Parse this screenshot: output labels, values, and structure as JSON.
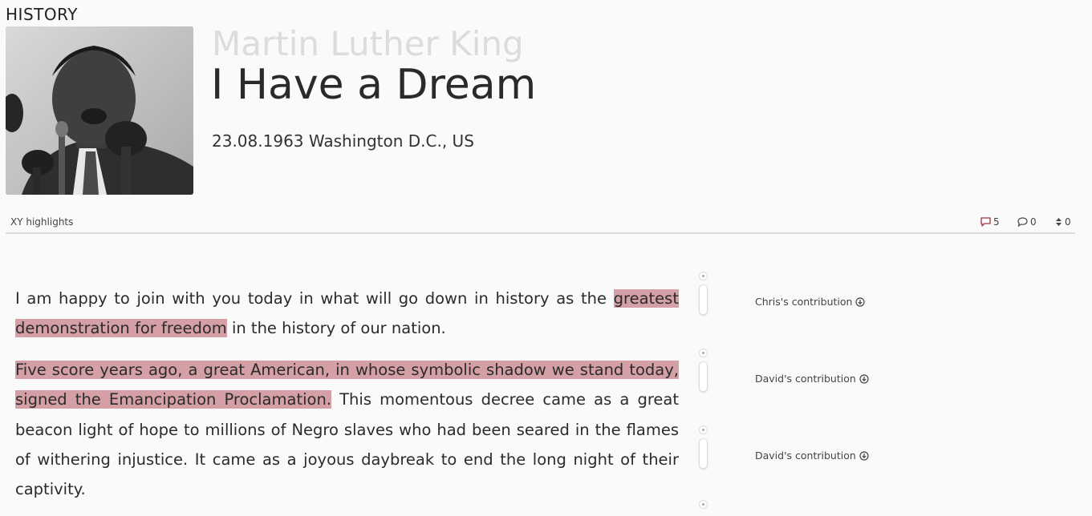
{
  "header": {
    "category": "HISTORY",
    "author": "Martin Luther King",
    "title": "I Have a Dream",
    "meta": "23.08.1963 Washington D.C., US"
  },
  "toolbar": {
    "highlights_label": "XY highlights",
    "stats": [
      {
        "icon": "comment-icon",
        "value": "5",
        "color": "#a0323c"
      },
      {
        "icon": "chat-bubble-icon",
        "value": "0",
        "color": "#444444"
      },
      {
        "icon": "sort-arrows-icon",
        "value": "0",
        "color": "#444444"
      }
    ]
  },
  "body": {
    "paragraphs": [
      {
        "highlight": "",
        "lead": "I am happy to join with you today in what will go down in history as the ",
        "marked": "greatest demonstration for freedom",
        "rest": " in the history of our nation."
      },
      {
        "lead": "",
        "marked": "Five score years ago, a great American, in whose symbolic shadow we stand today, signed the Emancipation Proclamation.",
        "rest": " This momentous decree came as a great beacon light of hope to millions of Negro slaves who had been seared in the flames of withering injustice. It came as a joyous daybreak to end the long night of their captivity."
      }
    ]
  },
  "contributions": [
    {
      "label": "Chris's contribution",
      "icon": "arrow-down-circle-icon"
    },
    {
      "label": "David's contribution",
      "icon": "arrow-down-circle-icon"
    },
    {
      "label": "David's contribution",
      "icon": "arrow-down-circle-icon"
    }
  ],
  "colors": {
    "highlight": "#d4a0a6",
    "accent": "#a0323c"
  }
}
